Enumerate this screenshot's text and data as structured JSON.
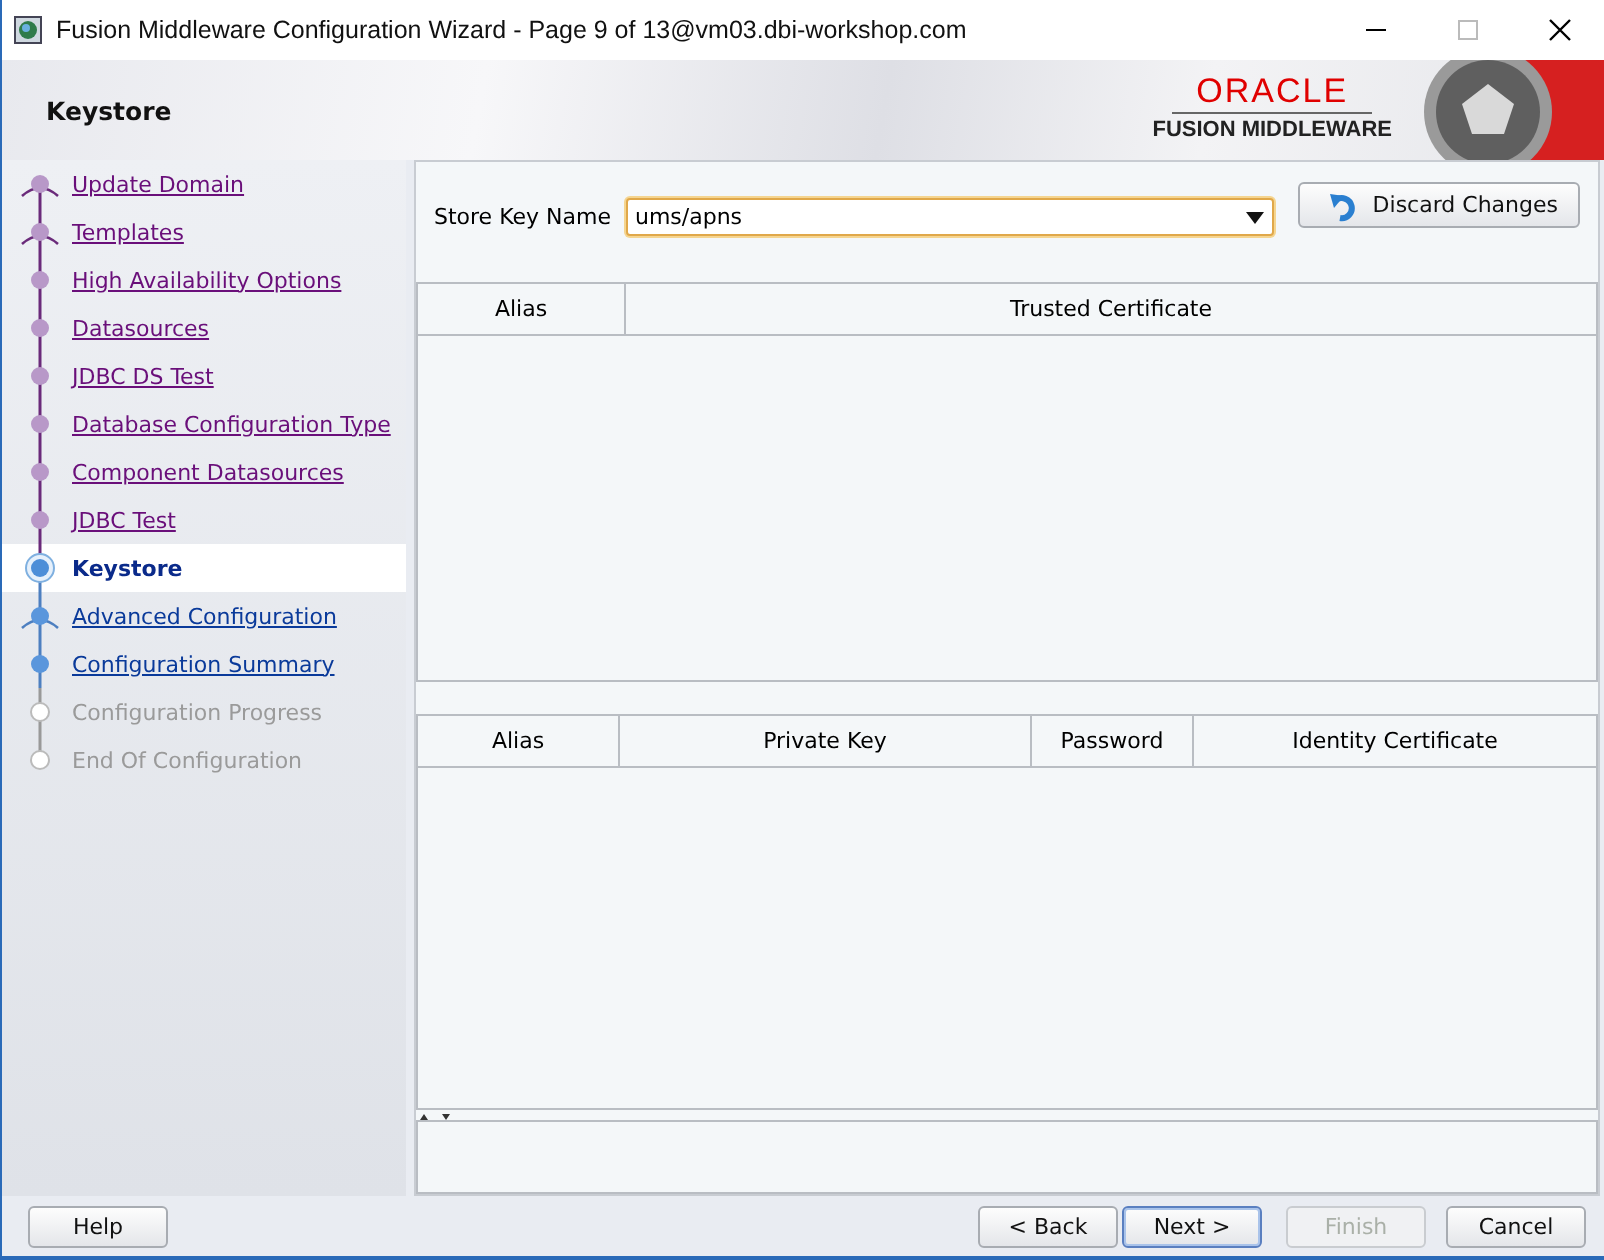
{
  "window": {
    "title": "Fusion Middleware Configuration Wizard - Page 9 of 13@vm03.dbi-workshop.com"
  },
  "header": {
    "title": "Keystore",
    "logo_top": "ORACLE",
    "logo_bottom": "FUSION MIDDLEWARE"
  },
  "steps": [
    {
      "label": "Update Domain",
      "visited": true,
      "selected": false,
      "disabled": false,
      "branch": true
    },
    {
      "label": "Templates",
      "visited": true,
      "selected": false,
      "disabled": false,
      "branch": true
    },
    {
      "label": "High Availability Options",
      "visited": true,
      "selected": false,
      "disabled": false,
      "branch": false
    },
    {
      "label": "Datasources",
      "visited": true,
      "selected": false,
      "disabled": false,
      "branch": false
    },
    {
      "label": "JDBC DS Test",
      "visited": true,
      "selected": false,
      "disabled": false,
      "branch": false
    },
    {
      "label": "Database Configuration Type",
      "visited": true,
      "selected": false,
      "disabled": false,
      "branch": false
    },
    {
      "label": "Component Datasources",
      "visited": true,
      "selected": false,
      "disabled": false,
      "branch": false
    },
    {
      "label": "JDBC Test",
      "visited": true,
      "selected": false,
      "disabled": false,
      "branch": false
    },
    {
      "label": "Keystore",
      "visited": false,
      "selected": true,
      "disabled": false,
      "branch": false
    },
    {
      "label": "Advanced Configuration",
      "visited": false,
      "selected": false,
      "disabled": false,
      "branch": true
    },
    {
      "label": "Configuration Summary",
      "visited": false,
      "selected": false,
      "disabled": false,
      "branch": false
    },
    {
      "label": "Configuration Progress",
      "visited": false,
      "selected": false,
      "disabled": true,
      "branch": false
    },
    {
      "label": "End Of Configuration",
      "visited": false,
      "selected": false,
      "disabled": true,
      "branch": false
    }
  ],
  "store_key": {
    "label": "Store Key Name",
    "value": "ums/apns"
  },
  "discard_button": "Discard Changes",
  "trusted_table": {
    "columns": [
      "Alias",
      "Trusted Certificate"
    ]
  },
  "private_table": {
    "columns": [
      "Alias",
      "Private Key",
      "Password",
      "Identity Certificate"
    ]
  },
  "buttons": [
    {
      "label": "Help",
      "kind": "help",
      "disabled": false,
      "default": false
    },
    {
      "label": "< Back",
      "kind": "nav",
      "disabled": false,
      "default": false
    },
    {
      "label": "Next >",
      "kind": "nav",
      "disabled": false,
      "default": true
    },
    {
      "label": "Finish",
      "kind": "nav",
      "disabled": true,
      "default": false
    },
    {
      "label": "Cancel",
      "kind": "nav",
      "disabled": false,
      "default": false
    }
  ]
}
